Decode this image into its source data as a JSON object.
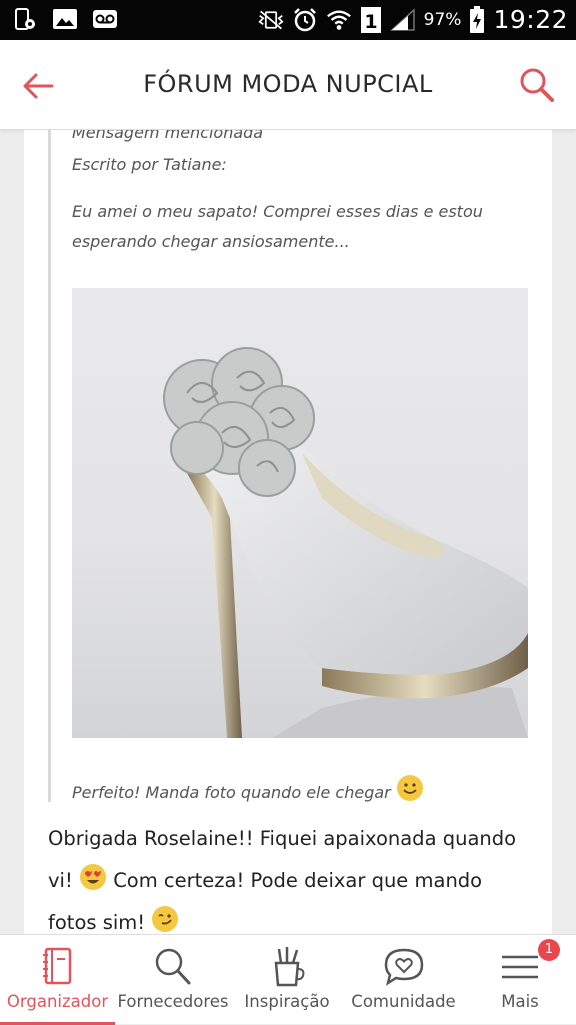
{
  "status_bar": {
    "battery_level": "97%",
    "sim_slot": "1",
    "time": "19:22"
  },
  "app_bar": {
    "title": "FÓRUM MODA NUPCIAL"
  },
  "quote": {
    "mentioned_label": "Mensagem mencionada",
    "author_line": "Escrito por Tatiane:",
    "text_line_1": "Eu amei o meu sapato! Comprei esses dias e estou",
    "text_line_2": "esperando chegar ansiosamente...",
    "reply_text": "Perfeito! Manda foto quando ele chegar"
  },
  "post": {
    "line_1": "Obrigada Roselaine!! Fiquei apaixonada quando",
    "line_2a": "vi!",
    "line_2b": "Com certeza! Pode deixar que mando",
    "line_3": "fotos sim!"
  },
  "tabs": [
    {
      "label": "Organizador",
      "icon": "notebook-icon",
      "active": true
    },
    {
      "label": "Fornecedores",
      "icon": "search-icon"
    },
    {
      "label": "Inspiração",
      "icon": "pencil-cup-icon"
    },
    {
      "label": "Comunidade",
      "icon": "chat-heart-icon"
    },
    {
      "label": "Mais",
      "icon": "menu-icon",
      "badge": "1"
    }
  ],
  "colors": {
    "accent": "#e0555b",
    "status_bar": "#050505"
  }
}
